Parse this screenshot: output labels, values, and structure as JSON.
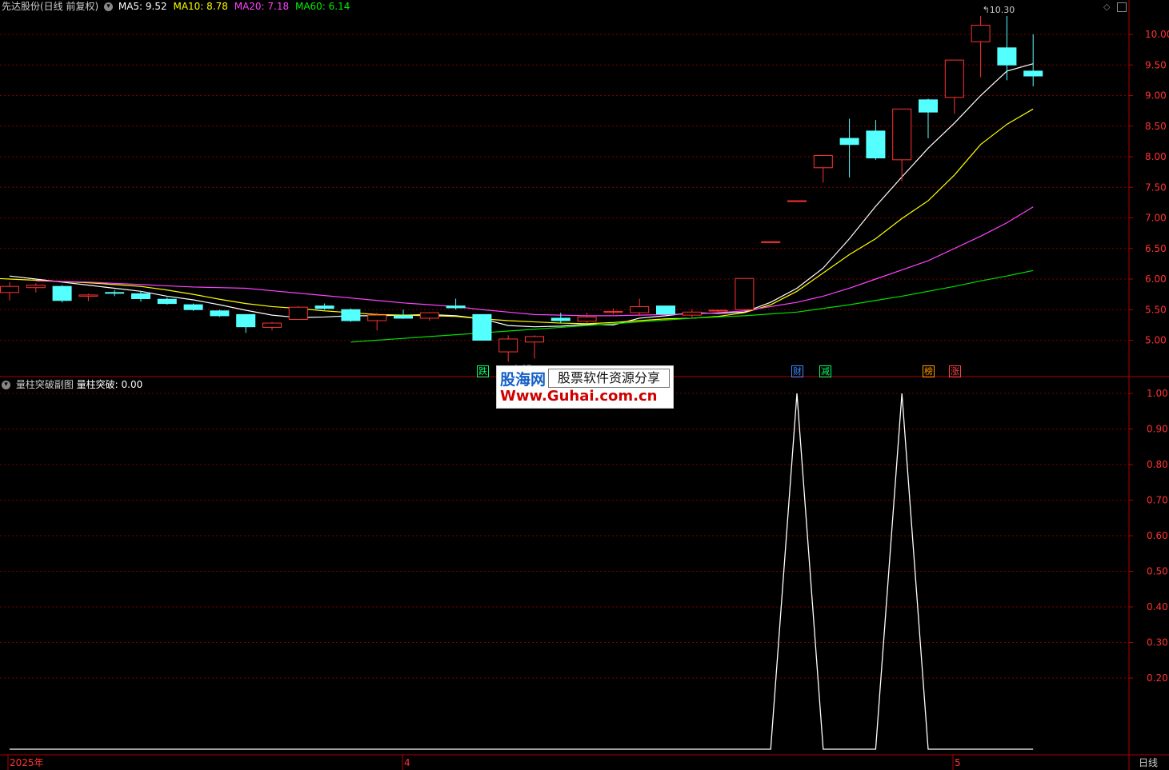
{
  "header": {
    "stock_title": "先达股份(日线 前复权)",
    "ma": [
      {
        "label": "MA5:",
        "value": "9.52",
        "color": "#ffffff"
      },
      {
        "label": "MA10:",
        "value": "8.78",
        "color": "#ffff00"
      },
      {
        "label": "MA20:",
        "value": "7.18",
        "color": "#ff44ff"
      },
      {
        "label": "MA60:",
        "value": "6.14",
        "color": "#00e000"
      }
    ]
  },
  "sub_header": {
    "title": "量柱突破副图",
    "indicator_label": "量柱突破:",
    "indicator_value": "0.00"
  },
  "markers": [
    {
      "text": "跌",
      "color": "#00ff66"
    },
    {
      "text": "财",
      "color": "#3f8bff"
    },
    {
      "text": "减",
      "color": "#00ff66"
    },
    {
      "text": "榜",
      "color": "#ff9900"
    },
    {
      "text": "涨",
      "color": "#ff4444"
    }
  ],
  "price_annotations": {
    "high_label": "10.30",
    "low_label": "4.65"
  },
  "x_axis": {
    "labels": [
      "2025年",
      "4",
      "5"
    ],
    "period_label": "日线"
  },
  "watermark": {
    "brand": "股海网",
    "tagline": "股票软件资源分享",
    "url": "Www.Guhai.com.cn"
  },
  "colors": {
    "up": "#ff3232",
    "down": "#54ffff",
    "grid": "#7a0000",
    "axis": "#b00000",
    "ma5": "#ffffff",
    "ma10": "#ffff00",
    "ma20": "#ff44ff",
    "ma60": "#00e000",
    "indicator": "#ffffff"
  },
  "chart_data": [
    {
      "type": "candlestick",
      "title": "先达股份(日线 前复权)",
      "y_ticks": [
        "10.00",
        "9.50",
        "9.00",
        "8.50",
        "8.00",
        "7.50",
        "7.00",
        "6.50",
        "6.00",
        "5.50",
        "5.00"
      ],
      "ylim": [
        4.5,
        10.4
      ],
      "candles": [
        {
          "o": 5.78,
          "h": 5.95,
          "l": 5.65,
          "c": 5.88
        },
        {
          "o": 5.86,
          "h": 5.93,
          "l": 5.78,
          "c": 5.9
        },
        {
          "o": 5.88,
          "h": 5.9,
          "l": 5.62,
          "c": 5.65
        },
        {
          "o": 5.72,
          "h": 5.76,
          "l": 5.64,
          "c": 5.74
        },
        {
          "o": 5.78,
          "h": 5.82,
          "l": 5.72,
          "c": 5.77
        },
        {
          "o": 5.76,
          "h": 5.8,
          "l": 5.63,
          "c": 5.68
        },
        {
          "o": 5.67,
          "h": 5.7,
          "l": 5.58,
          "c": 5.6
        },
        {
          "o": 5.58,
          "h": 5.6,
          "l": 5.48,
          "c": 5.5
        },
        {
          "o": 5.48,
          "h": 5.5,
          "l": 5.38,
          "c": 5.4
        },
        {
          "o": 5.42,
          "h": 5.42,
          "l": 5.12,
          "c": 5.22
        },
        {
          "o": 5.21,
          "h": 5.3,
          "l": 5.16,
          "c": 5.28
        },
        {
          "o": 5.34,
          "h": 5.56,
          "l": 5.34,
          "c": 5.54
        },
        {
          "o": 5.56,
          "h": 5.6,
          "l": 5.5,
          "c": 5.52
        },
        {
          "o": 5.5,
          "h": 5.52,
          "l": 5.3,
          "c": 5.32
        },
        {
          "o": 5.32,
          "h": 5.45,
          "l": 5.16,
          "c": 5.41
        },
        {
          "o": 5.4,
          "h": 5.5,
          "l": 5.35,
          "c": 5.36
        },
        {
          "o": 5.36,
          "h": 5.46,
          "l": 5.32,
          "c": 5.45
        },
        {
          "o": 5.56,
          "h": 5.68,
          "l": 5.5,
          "c": 5.53
        },
        {
          "o": 5.42,
          "h": 5.42,
          "l": 5.0,
          "c": 5.0
        },
        {
          "o": 4.81,
          "h": 5.08,
          "l": 4.65,
          "c": 5.02
        },
        {
          "o": 4.97,
          "h": 5.08,
          "l": 4.7,
          "c": 5.06
        },
        {
          "o": 5.36,
          "h": 5.45,
          "l": 5.28,
          "c": 5.32
        },
        {
          "o": 5.31,
          "h": 5.45,
          "l": 5.28,
          "c": 5.38
        },
        {
          "o": 5.46,
          "h": 5.52,
          "l": 5.42,
          "c": 5.47
        },
        {
          "o": 5.45,
          "h": 5.68,
          "l": 5.4,
          "c": 5.55
        },
        {
          "o": 5.56,
          "h": 5.56,
          "l": 5.42,
          "c": 5.43
        },
        {
          "o": 5.41,
          "h": 5.5,
          "l": 5.37,
          "c": 5.46
        },
        {
          "o": 5.48,
          "h": 5.5,
          "l": 5.46,
          "c": 5.49
        },
        {
          "o": 5.5,
          "h": 6.01,
          "l": 5.49,
          "c": 6.01
        },
        {
          "o": 6.61,
          "h": 6.61,
          "l": 6.61,
          "c": 6.61
        },
        {
          "o": 7.28,
          "h": 7.28,
          "l": 7.28,
          "c": 7.28
        },
        {
          "o": 7.82,
          "h": 8.02,
          "l": 7.58,
          "c": 8.02
        },
        {
          "o": 8.3,
          "h": 8.62,
          "l": 7.66,
          "c": 8.2
        },
        {
          "o": 8.42,
          "h": 8.6,
          "l": 7.95,
          "c": 7.98
        },
        {
          "o": 7.95,
          "h": 8.78,
          "l": 7.6,
          "c": 8.78
        },
        {
          "o": 8.93,
          "h": 8.95,
          "l": 8.3,
          "c": 8.73
        },
        {
          "o": 8.97,
          "h": 9.58,
          "l": 8.7,
          "c": 9.58
        },
        {
          "o": 9.88,
          "h": 10.3,
          "l": 9.3,
          "c": 10.15
        },
        {
          "o": 9.78,
          "h": 10.3,
          "l": 9.25,
          "c": 9.5
        },
        {
          "o": 9.4,
          "h": 10.0,
          "l": 9.15,
          "c": 9.32
        }
      ],
      "series": [
        {
          "name": "MA5",
          "values": [
            6.05,
            6.0,
            5.95,
            5.9,
            5.85,
            5.8,
            5.72,
            5.66,
            5.58,
            5.49,
            5.41,
            5.37,
            5.38,
            5.4,
            5.4,
            5.41,
            5.42,
            5.4,
            5.35,
            5.24,
            5.22,
            5.23,
            5.26,
            5.25,
            5.36,
            5.4,
            5.45,
            5.44,
            5.46,
            5.62,
            5.85,
            6.18,
            6.66,
            7.19,
            7.67,
            8.14,
            8.55,
            9.0,
            9.4,
            9.52
          ]
        },
        {
          "name": "MA10",
          "values": [
            6.02,
            6.0,
            5.98,
            5.96,
            5.94,
            5.91,
            5.88,
            5.82,
            5.75,
            5.67,
            5.6,
            5.55,
            5.52,
            5.48,
            5.45,
            5.42,
            5.41,
            5.4,
            5.39,
            5.35,
            5.32,
            5.3,
            5.28,
            5.27,
            5.29,
            5.32,
            5.35,
            5.36,
            5.39,
            5.45,
            5.58,
            5.8,
            6.1,
            6.4,
            6.66,
            6.99,
            7.28,
            7.7,
            8.2,
            8.53,
            8.78
          ]
        },
        {
          "name": "MA20",
          "values": [
            5.97,
            5.96,
            5.95,
            5.93,
            5.91,
            5.89,
            5.87,
            5.86,
            5.85,
            5.81,
            5.77,
            5.73,
            5.69,
            5.65,
            5.61,
            5.58,
            5.55,
            5.5,
            5.46,
            5.42,
            5.41,
            5.4,
            5.4,
            5.41,
            5.42,
            5.43,
            5.45,
            5.48,
            5.55,
            5.62,
            5.72,
            5.85,
            6.0,
            6.15,
            6.3,
            6.5,
            6.7,
            6.92,
            7.18
          ]
        },
        {
          "name": "MA60",
          "values": [
            4.97,
            5.0,
            5.03,
            5.06,
            5.09,
            5.12,
            5.15,
            5.18,
            5.21,
            5.24,
            5.27,
            5.3,
            5.33,
            5.36,
            5.38,
            5.4,
            5.43,
            5.46,
            5.52,
            5.58,
            5.65,
            5.72,
            5.8,
            5.88,
            5.97,
            6.05,
            6.14
          ]
        }
      ]
    },
    {
      "type": "line",
      "title": "量柱突破副图",
      "y_ticks": [
        "1.00",
        "0.90",
        "0.80",
        "0.70",
        "0.60",
        "0.50",
        "0.40",
        "0.30",
        "0.20"
      ],
      "ylim": [
        0,
        1.0
      ],
      "series": [
        {
          "name": "量柱突破",
          "values": [
            0,
            0,
            0,
            0,
            0,
            0,
            0,
            0,
            0,
            0,
            0,
            0,
            0,
            0,
            0,
            0,
            0,
            0,
            0,
            0,
            0,
            0,
            0,
            0,
            0,
            0,
            0,
            0,
            0,
            0,
            1,
            0,
            0,
            0,
            1,
            0,
            0,
            0,
            0,
            0
          ]
        }
      ]
    }
  ]
}
